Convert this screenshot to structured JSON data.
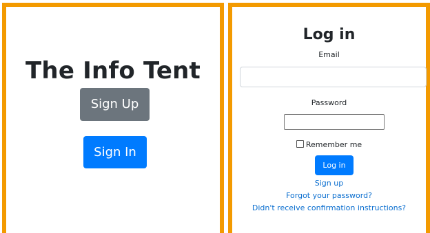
{
  "left_panel": {
    "title": "The Info Tent",
    "signup_label": "Sign Up",
    "signin_label": "Sign In"
  },
  "right_panel": {
    "title": "Log in",
    "email_label": "Email",
    "email_value": "",
    "password_label": "Password",
    "password_value": "",
    "remember_label": "Remember me",
    "remember_checked": false,
    "login_label": "Log in",
    "links": {
      "signup": "Sign up",
      "forgot": "Forgot your password?",
      "confirmation": "Didn't receive confirmation instructions?"
    }
  },
  "colors": {
    "frame": "#f39a00",
    "primary": "#007bff",
    "secondary": "#6c757d",
    "link": "#0a6ecf"
  }
}
